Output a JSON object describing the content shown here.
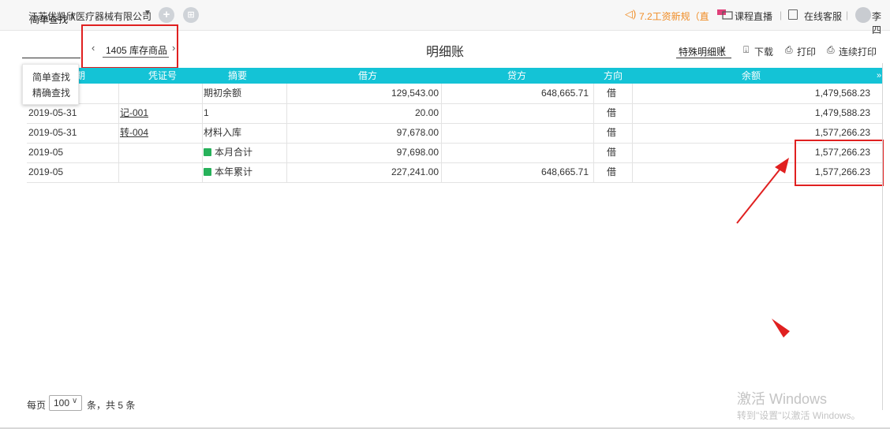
{
  "topbar": {
    "company": "江苏优凯欣医疗器械有限公司",
    "company_caret": "▼",
    "add_icon": "plus-circle-icon",
    "apps_icon": "apps-circle-icon",
    "news_icon": "speaker-icon",
    "news": "7.2工资新规（直",
    "live": "课程直播",
    "service": "在线客服",
    "user": "李四",
    "sep": "|"
  },
  "toolbar": {
    "search_label": "简单查找",
    "search_caret": "∧",
    "account_prev": "‹",
    "account": "1405  库存商品",
    "account_next": "›",
    "page_title": "明细账",
    "special": "特殊明细账",
    "special_caret": "∨",
    "download_icon": "⍗",
    "download": "下载",
    "print_icon": "⎙",
    "print": "打印",
    "cont_print_icon": "⎙",
    "cont_print": "连续打印"
  },
  "search_menu": {
    "items": [
      "简单查找",
      "精确查找"
    ]
  },
  "table": {
    "headers": [
      "日期",
      "凭证号",
      "摘要",
      "借方",
      "贷方",
      "方向",
      "余额"
    ],
    "header_visible_date": "期",
    "more_icon": "»",
    "rows": [
      {
        "date": "",
        "voucher": "",
        "summary": "期初余额",
        "debit": "129,543.00",
        "credit": "648,665.71",
        "direction": "借",
        "balance": "1,479,568.23",
        "badge": ""
      },
      {
        "date": "2019-05-31",
        "voucher": "记-001",
        "summary": "1",
        "debit": "20.00",
        "credit": "",
        "direction": "借",
        "balance": "1,479,588.23",
        "badge": ""
      },
      {
        "date": "2019-05-31",
        "voucher": "转-004",
        "summary": "材料入库",
        "debit": "97,678.00",
        "credit": "",
        "direction": "借",
        "balance": "1,577,266.23",
        "badge": ""
      },
      {
        "date": "2019-05",
        "voucher": "",
        "summary": "本月合计",
        "debit": "97,698.00",
        "credit": "",
        "direction": "借",
        "balance": "1,577,266.23",
        "badge": "月"
      },
      {
        "date": "2019-05",
        "voucher": "",
        "summary": "本年累计",
        "debit": "227,241.00",
        "credit": "648,665.71",
        "direction": "借",
        "balance": "1,577,266.23",
        "badge": "年"
      }
    ]
  },
  "pager": {
    "per_page_label": "每页",
    "per_page_value": "100",
    "caret": "∨",
    "total_text": "条，共 5 条"
  },
  "watermark": {
    "line1": "激活 Windows",
    "line2": "转到\"设置\"以激活 Windows。"
  },
  "colors": {
    "header_bg": "#14c3d6",
    "accent_orange": "#f08c25",
    "annotation_red": "#e02020",
    "badge_green": "#27b15a"
  }
}
